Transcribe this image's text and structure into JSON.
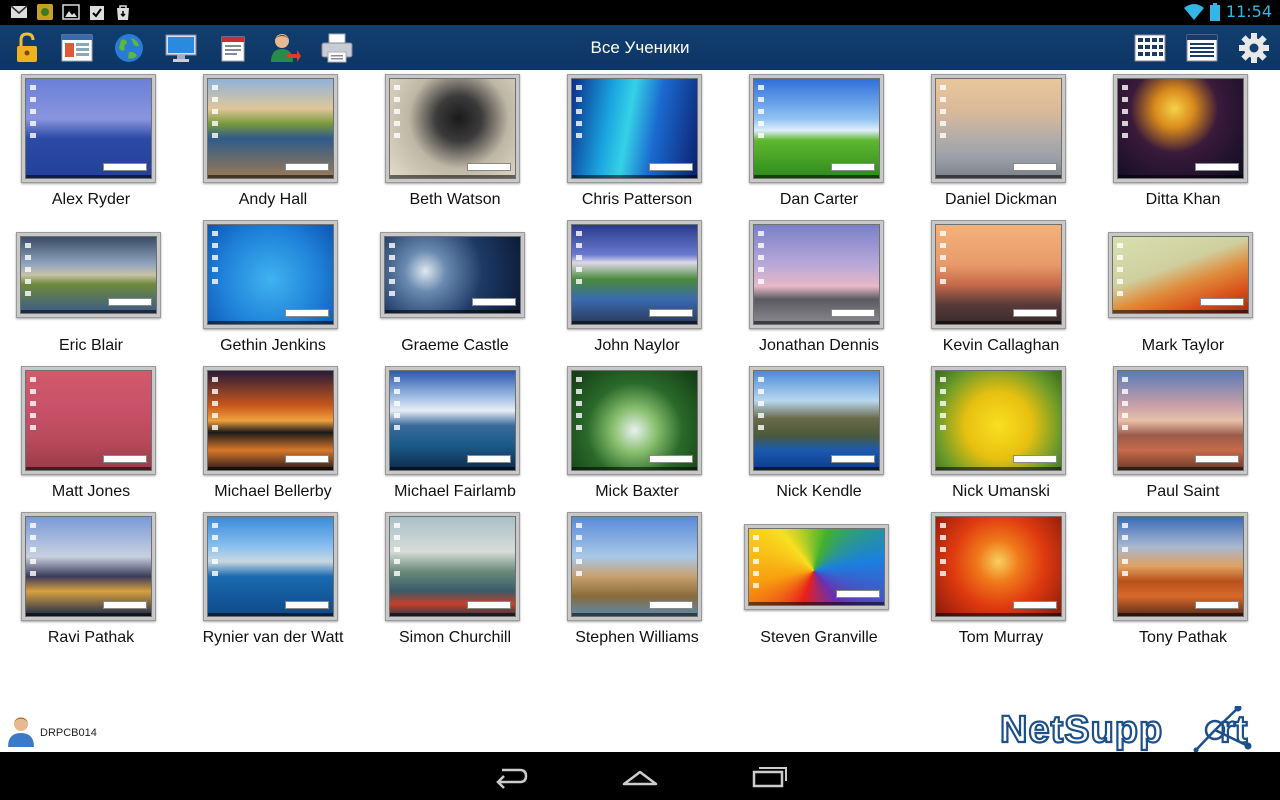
{
  "status_bar": {
    "icons": [
      "gmail-icon",
      "app-notification-icon",
      "gallery-icon",
      "clipboard-check-icon",
      "bag-download-icon"
    ],
    "time": "11:54"
  },
  "toolbar": {
    "title": "Все Ученики",
    "left_icons": [
      "lock-icon",
      "window-icon",
      "globe-icon",
      "monitor-icon",
      "messages-icon",
      "user-remove-icon",
      "printer-icon"
    ],
    "right_icons": [
      "grid-view-icon",
      "list-view-icon",
      "settings-gear-icon"
    ]
  },
  "students": [
    {
      "name": "Alex Ryder",
      "bg": "linear-gradient(180deg,#6a7fd6 0%,#8a95df 40%,#2c4aa6 60%,#23409a 100%)"
    },
    {
      "name": "Andy Hall",
      "bg": "linear-gradient(180deg,#8fb3d9 0%,#e0c69a 30%,#7a9a3c 45%,#2f5a8a 60%,#9a7a55 100%)"
    },
    {
      "name": "Beth Watson",
      "bg": "radial-gradient(circle at 55% 40%,#1a1a1a 0%,#3b3b3b 25%,#bfb7a6 55%,#e4ddcc 100%)"
    },
    {
      "name": "Chris Patterson",
      "bg": "linear-gradient(100deg,#0b2e8a 0%,#1aa4e0 30%,#35d2e6 45%,#1b6ad0 65%,#0b2170 100%)"
    },
    {
      "name": "Dan Carter",
      "bg": "linear-gradient(180deg,#2f6fd8 0%,#8fc2f2 40%,#dfeefc 52%,#5fb830 62%,#2e8a1c 100%)"
    },
    {
      "name": "Daniel Dickman",
      "bg": "linear-gradient(180deg,#e9c79a 0%,#d8b89a 35%,#b8b0a8 55%,#9aa0a8 80%,#7b8088 100%)"
    },
    {
      "name": "Ditta Khan",
      "bg": "radial-gradient(circle at 45% 30%,#f6d24a 0%,#d98a1c 20%,#3a1a3a 45%,#0c0c24 100%)"
    },
    {
      "name": "Eric Blair",
      "bg": "linear-gradient(180deg,#3a4c66 0%,#8ea3bd 35%,#c8c2a8 50%,#6f8a3a 62%,#3b5a8a 100%)",
      "landscape": true
    },
    {
      "name": "Gethin Jenkins",
      "bg": "radial-gradient(circle at 50% 55%,#3fb3f0 0%,#1f80d8 60%,#0e55b0 100%)"
    },
    {
      "name": "Graeme Castle",
      "bg": "radial-gradient(circle at 30% 45%,#dfe8f0 0%,#6a8ab0 20%,#1d3a66 55%,#0b1a33 100%)",
      "landscape": true
    },
    {
      "name": "John Naylor",
      "bg": "linear-gradient(180deg,#2a3a8a 0%,#6a7ad0 30%,#ded8e8 38%,#4a8a3a 55%,#3a6ab0 75%,#2a3a5a 100%)"
    },
    {
      "name": "Jonathan Dennis",
      "bg": "linear-gradient(180deg,#7a80c8 0%,#b8a8d8 40%,#e8b8c8 62%,#5a5a60 75%,#8a8a90 100%)"
    },
    {
      "name": "Kevin Callaghan",
      "bg": "linear-gradient(180deg,#f3b27a 0%,#e89a6a 40%,#c66a4a 60%,#5a3a3a 80%,#3a2a2a 100%)"
    },
    {
      "name": "Mark Taylor",
      "bg": "linear-gradient(160deg,#d8e0b0 0%,#cfd0a0 40%,#e08a3a 60%,#d8501a 80%,#a02a10 100%)",
      "landscape": true
    },
    {
      "name": "Matt Jones",
      "bg": "linear-gradient(180deg,#d25a6a 0%,#c8506a 40%,#b84a5a 70%,#9a3a4a 100%)"
    },
    {
      "name": "Michael Bellerby",
      "bg": "linear-gradient(180deg,#2a1a3a 0%,#c8581a 35%,#f0a040 50%,#1a1a1a 62%,#d8782a 80%,#2a1a1a 100%)"
    },
    {
      "name": "Michael Fairlamb",
      "bg": "linear-gradient(180deg,#2a5ab0 0%,#9ab8e0 25%,#e8eef8 40%,#3a6a9a 55%,#1a5a8a 75%,#0e2a4a 100%)"
    },
    {
      "name": "Mick Baxter",
      "bg": "radial-gradient(circle at 50% 60%,#e8f0f0 0%,#8ac070 25%,#2a6a2a 55%,#123a12 100%)"
    },
    {
      "name": "Nick Kendle",
      "bg": "linear-gradient(180deg,#4a8ad8 0%,#b8d8f0 30%,#6a6a4a 48%,#4a5a3a 65%,#1a5ab0 80%,#0e3a8a 100%)"
    },
    {
      "name": "Nick Umanski",
      "bg": "radial-gradient(circle at 50% 55%,#f8e020 0%,#e8c010 40%,#6a9a2a 75%,#3a6a1a 100%)"
    },
    {
      "name": "Paul Saint",
      "bg": "linear-gradient(180deg,#5a7ab8 0%,#c8a0a8 35%,#e8c0a8 50%,#9a5a4a 65%,#c86a4a 80%,#6a3a2a 100%)"
    },
    {
      "name": "Ravi Pathak",
      "bg": "linear-gradient(180deg,#7a9ad8 0%,#c8d0e0 40%,#3a3a5a 60%,#d8a040 75%,#1a2a4a 100%)"
    },
    {
      "name": "Rynier van der Watt",
      "bg": "linear-gradient(180deg,#3a8ad8 0%,#8ac0f0 30%,#c8d8e0 45%,#1a6ab0 60%,#0e4a8a 100%)"
    },
    {
      "name": "Simon Churchill",
      "bg": "linear-gradient(180deg,#a8c0c8 0%,#d8dcd8 35%,#6a8a7a 55%,#3a5a6a 75%,#c8402a 88%,#2a3a4a 100%)"
    },
    {
      "name": "Stephen Williams",
      "bg": "linear-gradient(180deg,#5a8ad8 0%,#a8c8e8 40%,#c8a070 60%,#8a6a3a 80%,#5a8ab0 100%)"
    },
    {
      "name": "Steven Granville",
      "bg": "conic-gradient(from 200deg at 48% 55%,#e8201a,#f8a010,#f8e020,#40b030,#1a80e0,#6a30b0,#e8201a)",
      "landscape": true
    },
    {
      "name": "Tom Murray",
      "bg": "radial-gradient(circle at 50% 45%,#f8d060 0%,#f07a1a 25%,#e03a10 55%,#8a1a0a 100%)"
    },
    {
      "name": "Tony Pathak",
      "bg": "linear-gradient(180deg,#3a6ab8 0%,#a8b8d0 30%,#e0a060 50%,#b8501a 65%,#d86a2a 80%,#5a2a1a 100%)"
    }
  ],
  "footer": {
    "computer_name": "DRPCB014",
    "brand": "NetSupport"
  },
  "nav": {
    "buttons": [
      "back-icon",
      "home-icon",
      "recent-apps-icon"
    ]
  },
  "colors": {
    "action_bar": "#0f3d6e",
    "clock": "#33b5e5",
    "brand_blue": "#1a4f8a"
  }
}
